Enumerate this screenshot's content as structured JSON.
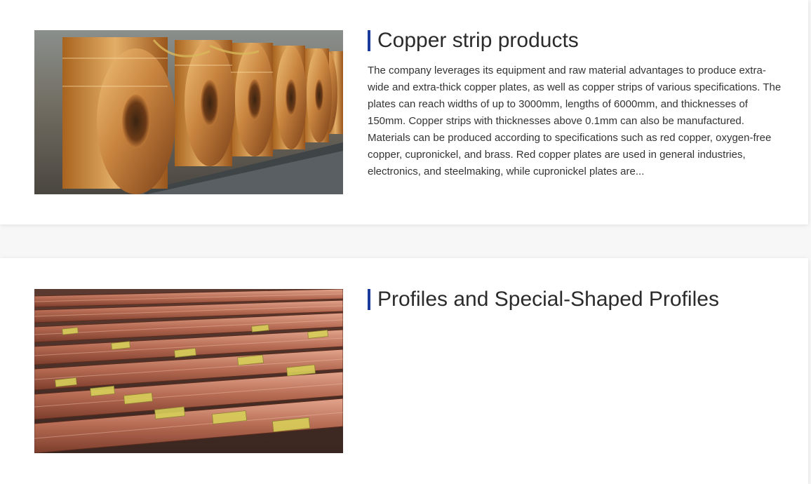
{
  "products": [
    {
      "title": "Copper strip products",
      "description": "The company leverages its equipment and raw material advantages to produce extra-wide and extra-thick copper plates, as well as copper strips of various specifications. The plates can reach widths of up to 3000mm, lengths of 6000mm, and thicknesses of 150mm. Copper strips with thicknesses above 0.1mm can also be manufactured. Materials can be produced according to specifications such as red copper, oxygen-free copper, cupronickel, and brass. Red copper plates are used in general industries, electronics, and steelmaking, while cupronickel plates are...",
      "image": "copper-coils-photo"
    },
    {
      "title": "Profiles and Special-Shaped Profiles",
      "description": "",
      "image": "copper-bars-photo"
    }
  ],
  "colors": {
    "accent": "#1b3b9c",
    "title_text": "#2b2b2b",
    "body_text": "#333333",
    "page_background": "#f7f7f7",
    "card_background": "#ffffff"
  }
}
